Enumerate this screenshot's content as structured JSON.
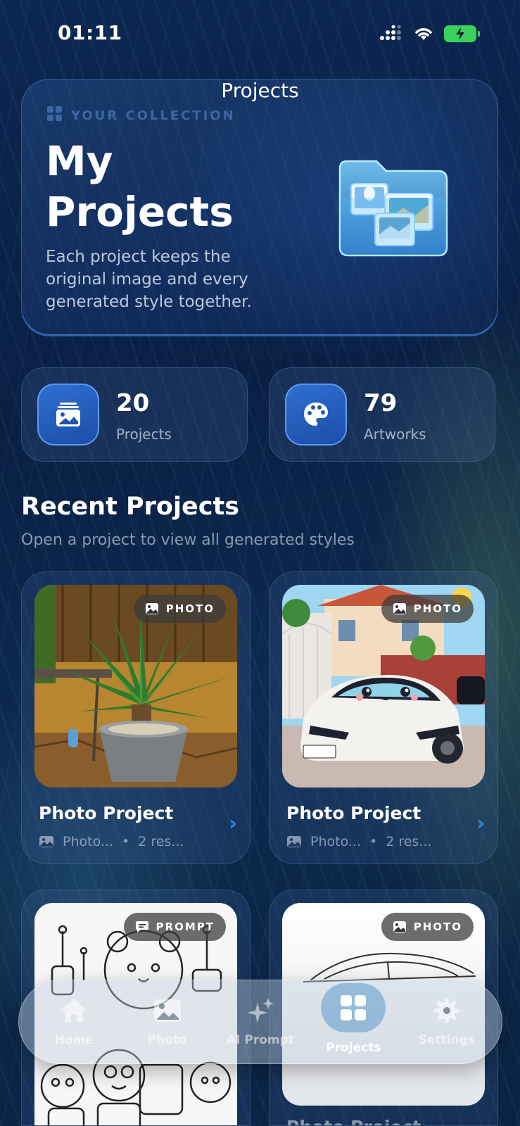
{
  "status": {
    "time": "01:11"
  },
  "nav": {
    "title": "Projects"
  },
  "hero": {
    "eyebrow": "YOUR COLLECTION",
    "title": "My Projects",
    "description": "Each project keeps the original image and every generated style together.",
    "folder_icon": "photo-folder-icon"
  },
  "stats": [
    {
      "value": "20",
      "label": "Projects",
      "icon": "gallery-icon"
    },
    {
      "value": "79",
      "label": "Artworks",
      "icon": "palette-icon"
    }
  ],
  "recent": {
    "title": "Recent Projects",
    "subtitle": "Open a project to view all generated styles"
  },
  "projects": [
    {
      "title": "Photo Project",
      "badge": "PHOTO",
      "meta_type": "Photo...",
      "meta_results": "2 res...",
      "thumbnail": "palm-plant-photo"
    },
    {
      "title": "Photo Project",
      "badge": "PHOTO",
      "meta_type": "Photo...",
      "meta_results": "2 res...",
      "thumbnail": "cartoon-car-photo"
    },
    {
      "badge": "PROMPT",
      "thumbnail": "robot-hamster-coloring-page"
    },
    {
      "badge": "PHOTO",
      "title": "Photo Project",
      "thumbnail": "car-line-drawing"
    }
  ],
  "tabbar": {
    "items": [
      {
        "label": "Home",
        "icon": "home-icon"
      },
      {
        "label": "Photo",
        "icon": "image-icon"
      },
      {
        "label": "AI Prompt",
        "icon": "sparkles-icon"
      },
      {
        "label": "Projects",
        "icon": "grid-icon",
        "active": true
      },
      {
        "label": "Settings",
        "icon": "gear-icon"
      }
    ]
  },
  "colors": {
    "accent": "#2f8cff",
    "battery": "#3ad25c"
  }
}
